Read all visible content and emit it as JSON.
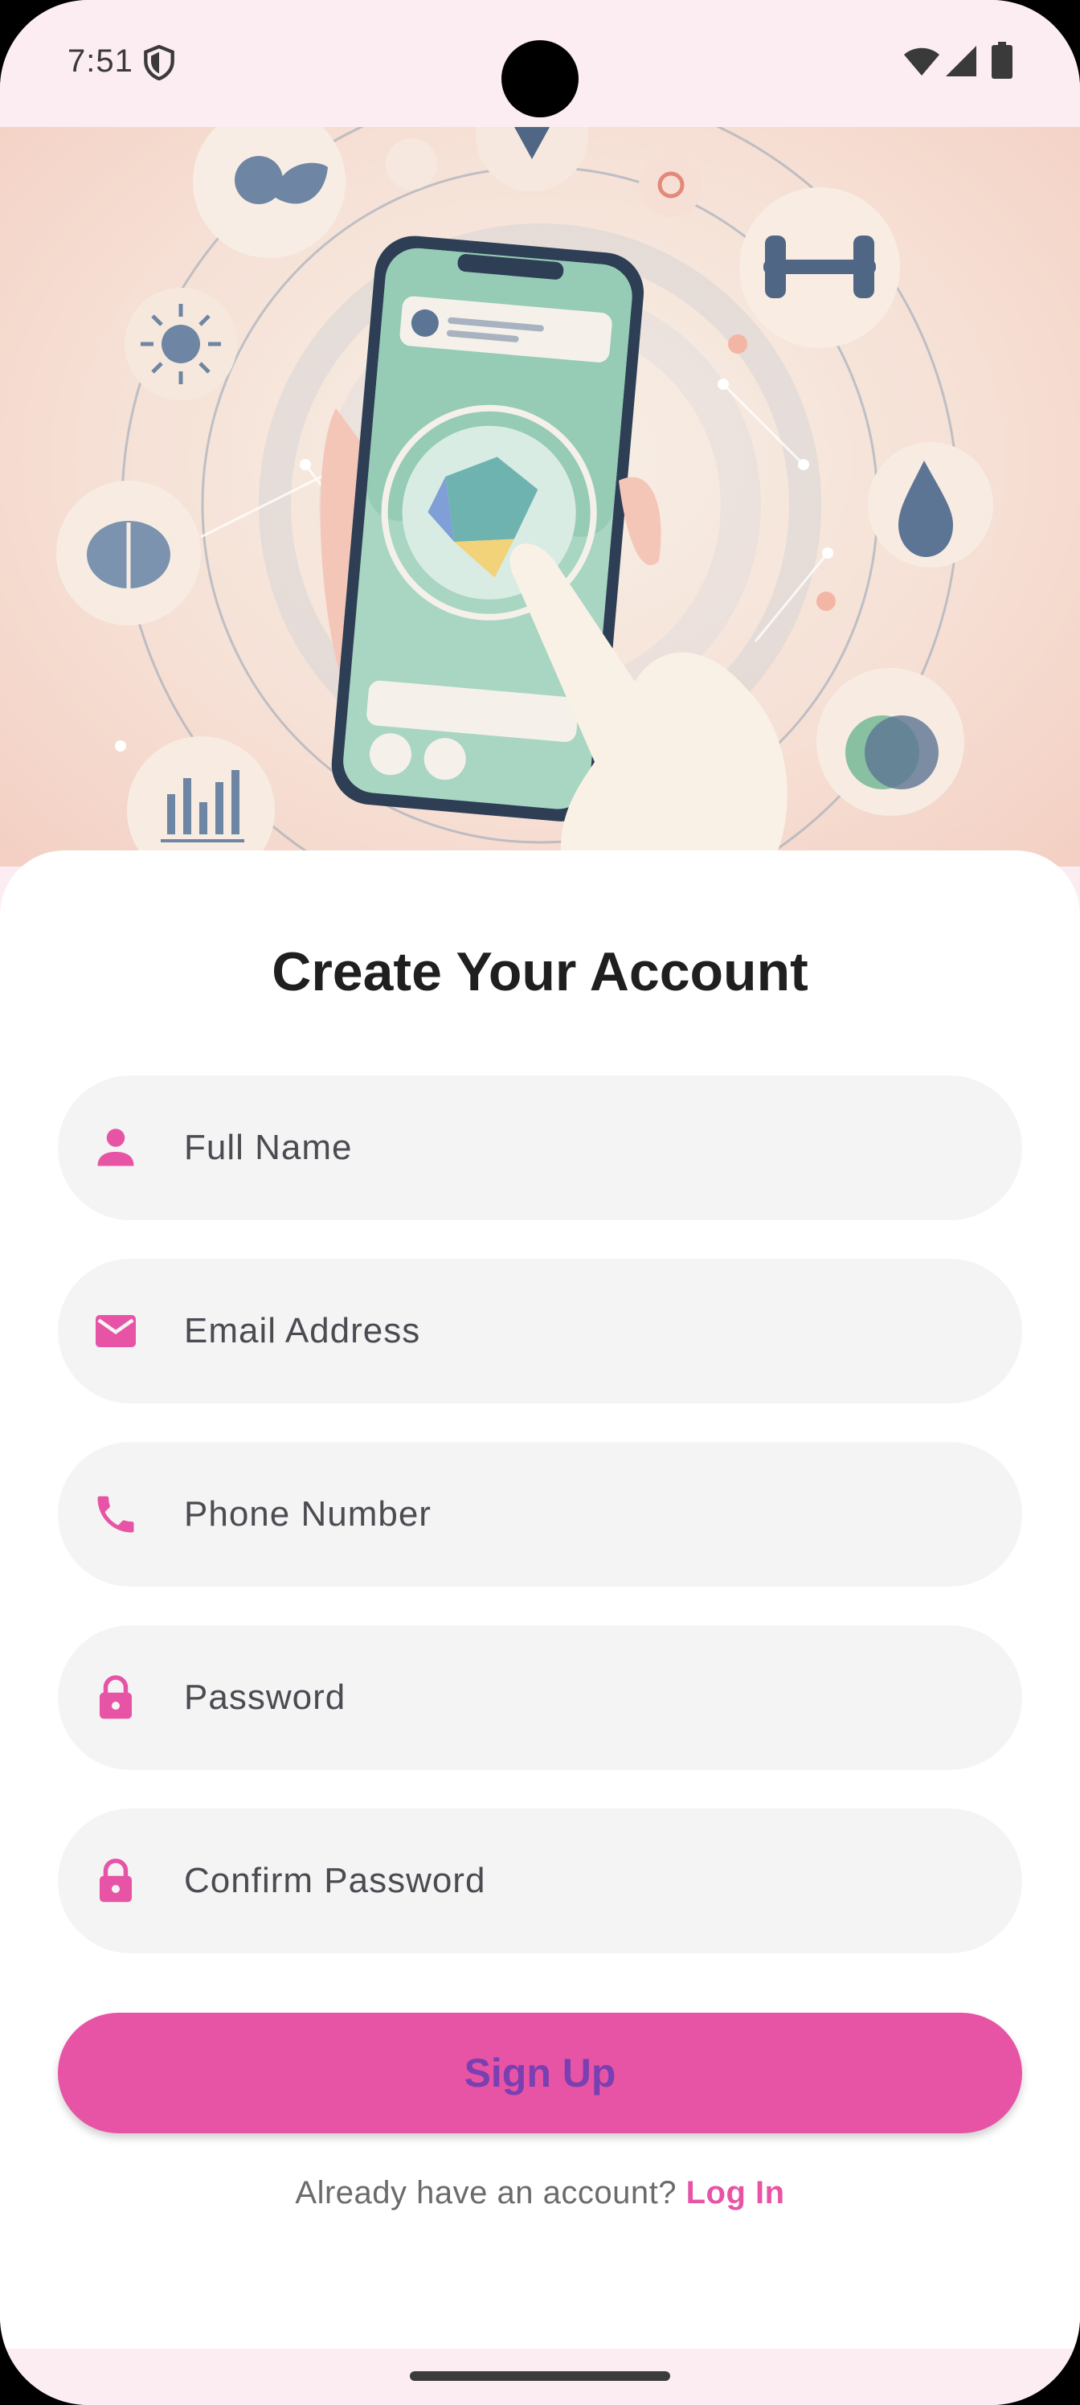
{
  "status_bar": {
    "time": "7:51",
    "icons": [
      "shield-icon",
      "wifi-icon",
      "signal-icon",
      "battery-icon"
    ]
  },
  "hero": {
    "image": "wellness-app-illustration"
  },
  "form": {
    "title": "Create Your Account",
    "fields": [
      {
        "icon": "person-icon",
        "placeholder": "Full Name"
      },
      {
        "icon": "mail-icon",
        "placeholder": "Email Address"
      },
      {
        "icon": "phone-icon",
        "placeholder": "Phone Number"
      },
      {
        "icon": "lock-icon",
        "placeholder": "Password"
      },
      {
        "icon": "lock-icon",
        "placeholder": "Confirm Password"
      }
    ],
    "signup_label": "Sign Up",
    "login_prompt": "Already have an account?",
    "login_link": "Log In"
  },
  "colors": {
    "accent": "#e754a5",
    "button_text": "#7a3fb0",
    "field_bg": "#f4f4f4",
    "status_bg": "#fcedf2"
  }
}
